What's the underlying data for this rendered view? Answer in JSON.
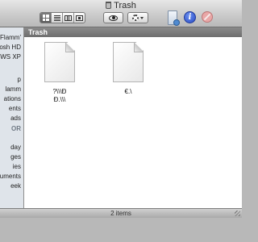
{
  "window": {
    "title": "Trash",
    "status": "2 items"
  },
  "toolbar": {
    "view_modes": [
      "icon-view",
      "list-view",
      "column-view",
      "cover-flow-view"
    ],
    "active_view": "icon-view"
  },
  "sidebar": {
    "items": [
      {
        "label": "Flamm'",
        "type": "device"
      },
      {
        "label": "osh HD",
        "type": "device"
      },
      {
        "label": "WS XP",
        "type": "device"
      },
      {
        "label": "p",
        "type": "place"
      },
      {
        "label": "lamm",
        "type": "place"
      },
      {
        "label": "ations",
        "type": "place"
      },
      {
        "label": "ents",
        "type": "place"
      },
      {
        "label": "ads",
        "type": "place"
      },
      {
        "label": "OR",
        "type": "header"
      },
      {
        "label": "day",
        "type": "search"
      },
      {
        "label": "ges",
        "type": "search"
      },
      {
        "label": "ies",
        "type": "search"
      },
      {
        "label": "uments",
        "type": "search"
      },
      {
        "label": "eek",
        "type": "search"
      }
    ]
  },
  "main": {
    "path_label": "Trash",
    "files": [
      {
        "name": "?\\\\\\Ð\nÐ.\\\\\\"
      },
      {
        "name": "€.\\"
      }
    ]
  },
  "colors": {
    "info_blue": "#2a4cc4",
    "sidebar_bg": "#dfe4ea",
    "pathbar_bg": "#7a7a7a"
  }
}
